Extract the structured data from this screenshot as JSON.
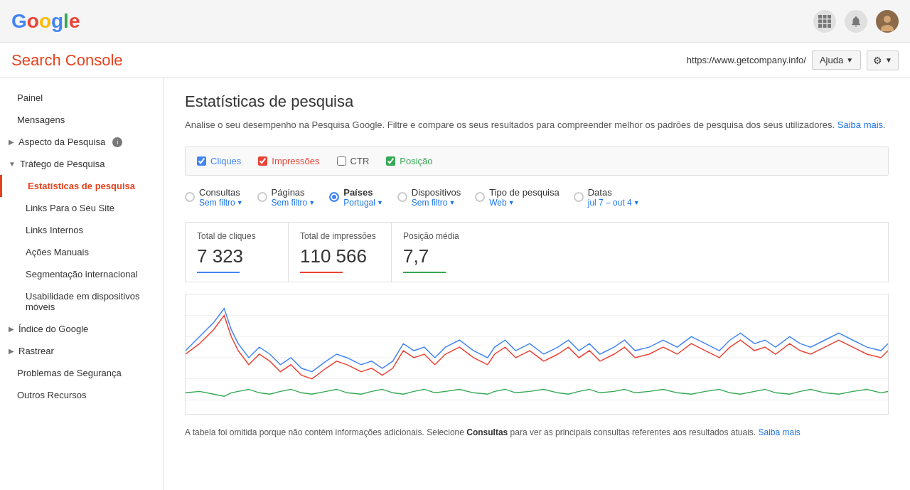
{
  "topbar": {
    "logo": "Google",
    "logo_letters": [
      {
        "char": "G",
        "color": "#4285F4"
      },
      {
        "char": "o",
        "color": "#EA4335"
      },
      {
        "char": "o",
        "color": "#FBBC05"
      },
      {
        "char": "g",
        "color": "#4285F4"
      },
      {
        "char": "l",
        "color": "#34A853"
      },
      {
        "char": "e",
        "color": "#EA4335"
      }
    ],
    "apps_icon": "⠿",
    "notification_icon": "🔔",
    "avatar_text": "👤"
  },
  "header": {
    "title": "Search Console",
    "url": "https://www.getcompany.info/",
    "ajuda_label": "Ajuda",
    "settings_icon": "⚙"
  },
  "sidebar": {
    "items": [
      {
        "id": "painel",
        "label": "Painel",
        "level": "top",
        "active": false
      },
      {
        "id": "mensagens",
        "label": "Mensagens",
        "level": "top",
        "active": false
      },
      {
        "id": "aspecto-pesquisa",
        "label": "Aspecto da Pesquisa",
        "level": "parent",
        "has_info": true,
        "expanded": false
      },
      {
        "id": "trafego-pesquisa",
        "label": "Tráfego de Pesquisa",
        "level": "parent",
        "expanded": true
      },
      {
        "id": "estatisticas",
        "label": "Estatísticas de pesquisa",
        "level": "sub",
        "active": true
      },
      {
        "id": "links-site",
        "label": "Links Para o Seu Site",
        "level": "sub",
        "active": false
      },
      {
        "id": "links-internos",
        "label": "Links Internos",
        "level": "sub",
        "active": false
      },
      {
        "id": "acoes-manuais",
        "label": "Ações Manuais",
        "level": "sub",
        "active": false
      },
      {
        "id": "segmentacao",
        "label": "Segmentação internacional",
        "level": "sub",
        "active": false
      },
      {
        "id": "usabilidade",
        "label": "Usabilidade em dispositivos móveis",
        "level": "sub",
        "active": false
      },
      {
        "id": "indice",
        "label": "Índice do Google",
        "level": "parent",
        "expanded": false
      },
      {
        "id": "rastrear",
        "label": "Rastrear",
        "level": "parent",
        "expanded": false
      },
      {
        "id": "seguranca",
        "label": "Problemas de Segurança",
        "level": "top",
        "active": false
      },
      {
        "id": "outros",
        "label": "Outros Recursos",
        "level": "top",
        "active": false
      }
    ]
  },
  "main": {
    "page_title": "Estatísticas de pesquisa",
    "page_desc": "Analise o seu desempenho na Pesquisa Google. Filtre e compare os seus resultados para compreender melhor os padrões de pesquisa dos seus utilizadores.",
    "saiba_mais_link": "Saiba mais",
    "checkboxes": [
      {
        "id": "cliques",
        "label": "Cliques",
        "checked": true,
        "color": "#4285F4"
      },
      {
        "id": "impressoes",
        "label": "Impressões",
        "checked": true,
        "color": "#EA4335"
      },
      {
        "id": "ctr",
        "label": "CTR",
        "checked": false,
        "color": "#FF6D00"
      },
      {
        "id": "posicao",
        "label": "Posição",
        "checked": true,
        "color": "#34A853"
      }
    ],
    "filters": [
      {
        "id": "consultas",
        "label": "Consultas",
        "sub": "Sem filtro",
        "selected": false
      },
      {
        "id": "paginas",
        "label": "Páginas",
        "sub": "Sem filtro",
        "selected": false
      },
      {
        "id": "paises",
        "label": "Países",
        "sub": "Portugal",
        "selected": true
      },
      {
        "id": "dispositivos",
        "label": "Dispositivos",
        "sub": "Sem filtro",
        "selected": false
      },
      {
        "id": "tipo-pesquisa",
        "label": "Tipo de pesquisa",
        "sub": "Web",
        "selected": false
      },
      {
        "id": "datas",
        "label": "Datas",
        "sub": "jul 7 – out 4",
        "selected": false
      }
    ],
    "stats": [
      {
        "id": "cliques-total",
        "label": "Total de cliques",
        "value": "7 323",
        "color": "blue"
      },
      {
        "id": "impressoes-total",
        "label": "Total de impressões",
        "value": "110 566",
        "color": "red"
      },
      {
        "id": "posicao-media",
        "label": "Posição média",
        "value": "7,7",
        "color": "green"
      }
    ],
    "chart_footer": "A tabela foi omitida porque não contém informações adicionais. Selecione",
    "chart_footer_bold": "Consultas",
    "chart_footer2": "para ver as principais consultas referentes aos resultados atuais.",
    "chart_footer_link": "Saiba mais"
  }
}
